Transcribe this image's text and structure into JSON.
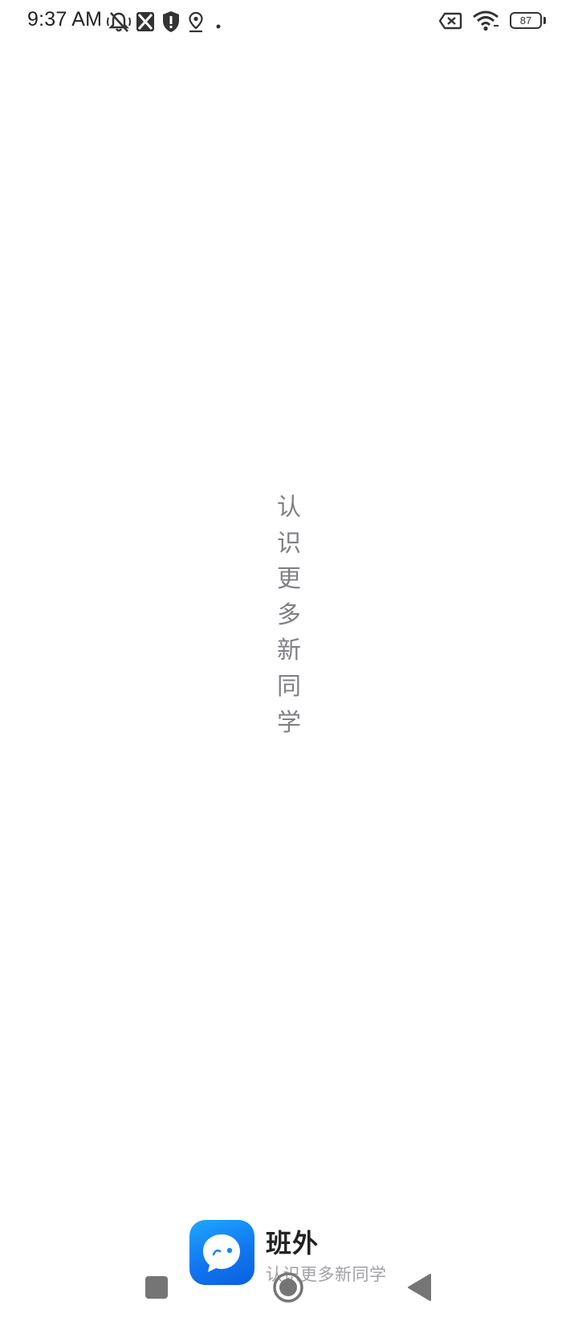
{
  "status_bar": {
    "time": "9:37 AM",
    "icons": [
      "bell-muted-icon",
      "sim-off-icon",
      "shield-alert-icon",
      "location-pin-icon",
      "dot-icon",
      "signal-off-icon",
      "wifi-icon"
    ],
    "battery_level": "87"
  },
  "splash": {
    "slogan_chars": [
      "认",
      "识",
      "更",
      "多",
      "新",
      "同",
      "学"
    ]
  },
  "brand": {
    "app_name": "班外",
    "tagline": "认识更多新同学",
    "logo_icon": "chat-bubble-icon",
    "logo_color_top": "#1ea8ff",
    "logo_color_bottom": "#0a5fe0"
  },
  "nav_bar": {
    "icons": [
      "recents-square-icon",
      "home-circle-icon",
      "back-triangle-icon"
    ]
  }
}
